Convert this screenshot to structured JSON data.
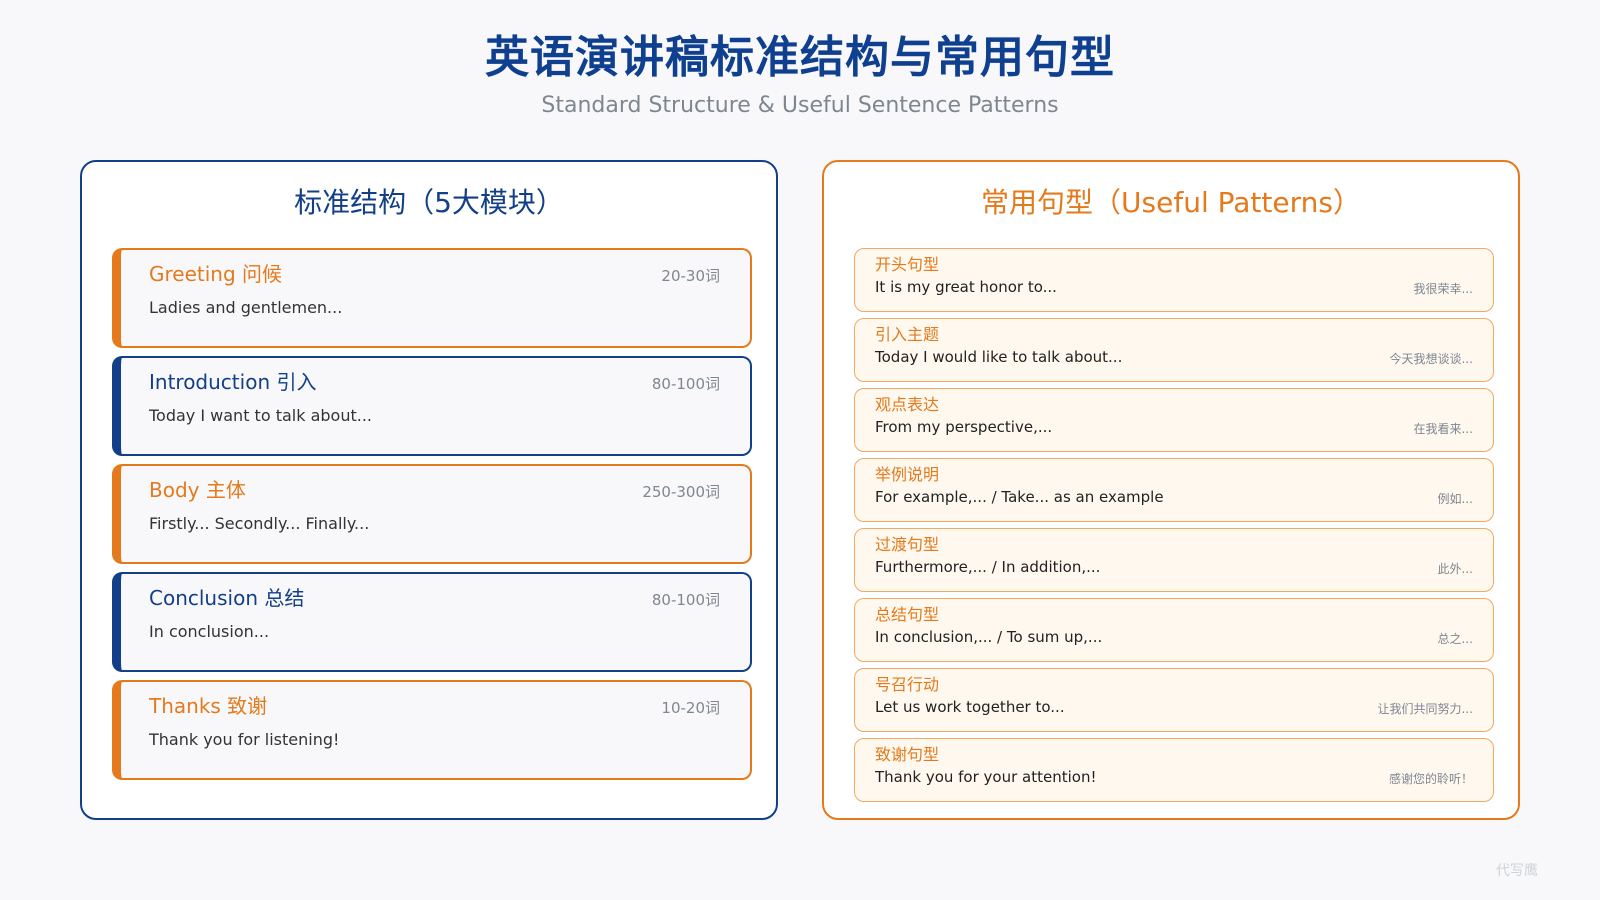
{
  "header": {
    "title": "英语演讲稿标准结构与常用句型",
    "subtitle": "Standard Structure & Useful Sentence Patterns"
  },
  "left_panel": {
    "title": "标准结构（5大模块）",
    "modules": [
      {
        "title": "Greeting 问候",
        "count": "20-30词",
        "example": "Ladies and gentlemen..."
      },
      {
        "title": "Introduction 引入",
        "count": "80-100词",
        "example": "Today I want to talk about..."
      },
      {
        "title": "Body 主体",
        "count": "250-300词",
        "example": "Firstly... Secondly... Finally..."
      },
      {
        "title": "Conclusion 总结",
        "count": "80-100词",
        "example": "In conclusion..."
      },
      {
        "title": "Thanks 致谢",
        "count": "10-20词",
        "example": "Thank you for listening!"
      }
    ]
  },
  "right_panel": {
    "title": "常用句型（Useful Patterns）",
    "patterns": [
      {
        "title": "开头句型",
        "en": "It is my great honor to...",
        "cn": "我很荣幸..."
      },
      {
        "title": "引入主题",
        "en": "Today I would like to talk about...",
        "cn": "今天我想谈谈..."
      },
      {
        "title": "观点表达",
        "en": "From my perspective,...",
        "cn": "在我看来..."
      },
      {
        "title": "举例说明",
        "en": "For example,... / Take... as an example",
        "cn": "例如..."
      },
      {
        "title": "过渡句型",
        "en": "Furthermore,... / In addition,...",
        "cn": "此外..."
      },
      {
        "title": "总结句型",
        "en": "In conclusion,... / To sum up,...",
        "cn": "总之..."
      },
      {
        "title": "号召行动",
        "en": "Let us work together to...",
        "cn": "让我们共同努力..."
      },
      {
        "title": "致谢句型",
        "en": "Thank you for your attention!",
        "cn": "感谢您的聆听！"
      }
    ]
  },
  "watermark": "代写鹰",
  "colors": {
    "navy": "#123f88",
    "orange": "#e47a1b",
    "background": "#f8f8fb"
  }
}
